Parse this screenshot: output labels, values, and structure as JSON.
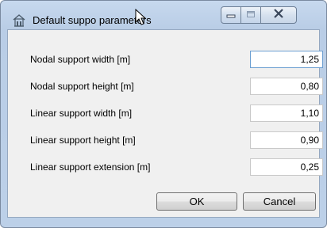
{
  "window": {
    "title": "Default suppo​ parameters",
    "controls": {
      "minimize": "minimize",
      "maximize": "maximize",
      "close": "close"
    }
  },
  "fields": [
    {
      "label": "Nodal support width [m]",
      "value": "1,25"
    },
    {
      "label": "Nodal support height [m]",
      "value": "0,80"
    },
    {
      "label": "Linear support width [m]",
      "value": "1,10"
    },
    {
      "label": "Linear support height [m]",
      "value": "0,90"
    },
    {
      "label": "Linear support extension [m]",
      "value": "0,25"
    }
  ],
  "buttons": {
    "ok": "OK",
    "cancel": "Cancel"
  },
  "colors": {
    "titlebar": "#c7d9ee",
    "client": "#f0f0f0",
    "focus_border": "#6c9fd2"
  },
  "icons": [
    "app-icon",
    "mouse-cursor-icon",
    "minimize-icon",
    "maximize-icon",
    "close-icon"
  ]
}
